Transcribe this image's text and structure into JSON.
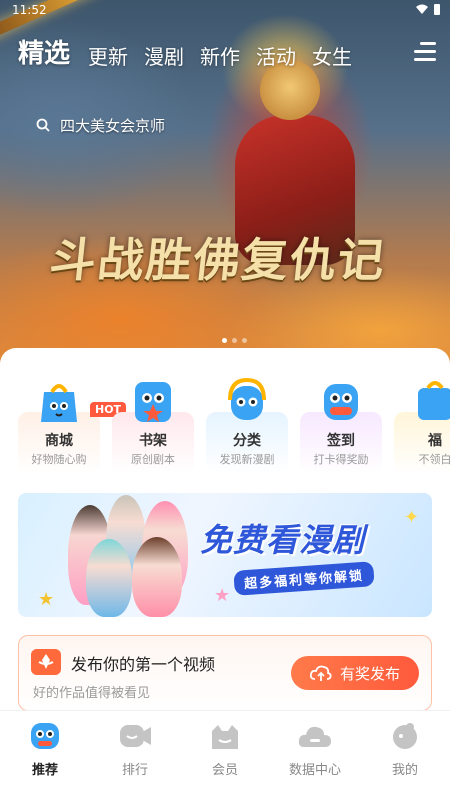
{
  "status": {
    "time": "11:52"
  },
  "tabs": [
    {
      "label": "精选"
    },
    {
      "label": "更新"
    },
    {
      "label": "漫剧"
    },
    {
      "label": "新作"
    },
    {
      "label": "活动"
    },
    {
      "label": "女生"
    }
  ],
  "search": {
    "text": "四大美女会京师"
  },
  "hero": {
    "title": "斗战胜佛复仇记"
  },
  "categories": [
    {
      "name": "商城",
      "sub": "好物随心购",
      "badge": "HOT",
      "color": "#fff0e6"
    },
    {
      "name": "书架",
      "sub": "原创剧本",
      "color": "#ffe8ec"
    },
    {
      "name": "分类",
      "sub": "发现新漫剧",
      "color": "#e6f4ff"
    },
    {
      "name": "签到",
      "sub": "打卡得奖励",
      "color": "#f7e8ff"
    },
    {
      "name": "福",
      "sub": "不领白",
      "color": "#fff5d9"
    }
  ],
  "promo": {
    "headline": "免费看漫剧",
    "badge": "超多福利等你解锁"
  },
  "publish": {
    "title": "发布你的第一个视频",
    "desc": "好的作品值得被看见",
    "button": "有奖发布"
  },
  "bottom_nav": [
    {
      "label": "推荐",
      "icon": "recommend-icon",
      "active": true
    },
    {
      "label": "排行",
      "icon": "ranking-icon"
    },
    {
      "label": "会员",
      "icon": "vip-icon"
    },
    {
      "label": "数据中心",
      "icon": "data-center-icon"
    },
    {
      "label": "我的",
      "icon": "profile-icon"
    }
  ],
  "colors": {
    "accent": "#ff5a3c",
    "blue": "#2f57d9"
  }
}
